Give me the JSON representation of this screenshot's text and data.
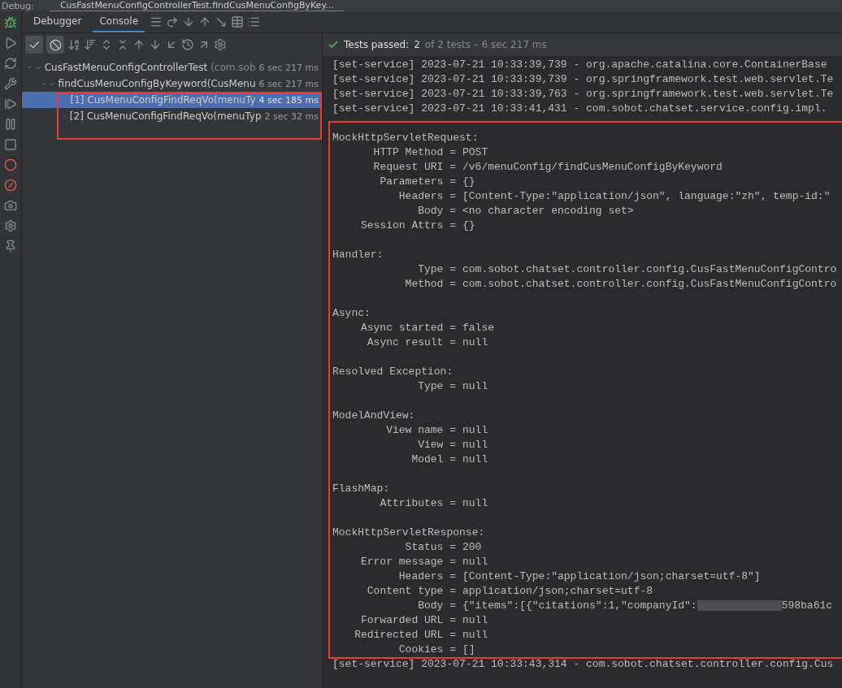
{
  "window": {
    "title": "Debug:",
    "tab": "CusFastMenuConfigControllerTest.findCusMenuConfigByKey..."
  },
  "tabs": [
    {
      "label": "Debugger",
      "selected": false
    },
    {
      "label": "Console",
      "selected": true
    }
  ],
  "filters": [
    {
      "kind": "passed",
      "on": true
    },
    {
      "kind": "ignored",
      "on": true
    }
  ],
  "tree": [
    {
      "name": "CusFastMenuConfigControllerTest",
      "detail": " (com.sob",
      "time": "6 sec 217 ms",
      "expanded": true,
      "selected": false,
      "passed": true,
      "children": [
        {
          "name": "findCusMenuConfigByKeyword(CusMenu",
          "time": "6 sec 217 ms",
          "expanded": true,
          "selected": false,
          "passed": true,
          "children": [
            {
              "name": "[1] CusMenuConfigFindReqVo(menuTy",
              "time": "4 sec 185 ms",
              "selected": true,
              "passed": true
            },
            {
              "name": "[2] CusMenuConfigFindReqVo(menuTyp",
              "time": "2 sec 32 ms",
              "selected": false,
              "passed": true
            }
          ]
        }
      ]
    }
  ],
  "status": {
    "label": "Tests passed:",
    "count": "2",
    "detail": "of 2 tests – 6 sec 217 ms",
    "passed": true
  },
  "console": [
    {
      "kind": "log",
      "text": "[set-service] 2023-07-21 10:33:39,739 - org.apache.catalina.core.ContainerBase"
    },
    {
      "kind": "log",
      "text": "[set-service] 2023-07-21 10:33:39,739 - org.springframework.test.web.servlet.Te"
    },
    {
      "kind": "log",
      "text": "[set-service] 2023-07-21 10:33:39,763 - org.springframework.test.web.servlet.Te"
    },
    {
      "kind": "log",
      "text": "[set-service] 2023-07-21 10:33:41,431 - com.sobot.chatset.service.config.impl."
    },
    {
      "kind": "blank"
    },
    {
      "kind": "heading",
      "text": "MockHttpServletRequest:"
    },
    {
      "kind": "field",
      "key": "HTTP Method =",
      "value": "POST"
    },
    {
      "kind": "field",
      "key": "Request URI =",
      "value": "/v6/menuConfig/findCusMenuConfigByKeyword"
    },
    {
      "kind": "field",
      "key": "Parameters =",
      "value": "{}"
    },
    {
      "kind": "field",
      "key": "Headers =",
      "value": "[Content-Type:\"application/json\", language:\"zh\", temp-id:\""
    },
    {
      "kind": "field",
      "key": "Body =",
      "value": "<no character encoding set>"
    },
    {
      "kind": "field",
      "key": "Session Attrs =",
      "value": "{}"
    },
    {
      "kind": "blank"
    },
    {
      "kind": "heading",
      "text": "Handler:"
    },
    {
      "kind": "field",
      "key": "Type =",
      "value": "com.sobot.chatset.controller.config.CusFastMenuConfigContro"
    },
    {
      "kind": "field",
      "key": "Method =",
      "value": "com.sobot.chatset.controller.config.CusFastMenuConfigContro"
    },
    {
      "kind": "blank"
    },
    {
      "kind": "heading",
      "text": "Async:"
    },
    {
      "kind": "field",
      "key": "Async started =",
      "value": "false"
    },
    {
      "kind": "field",
      "key": "Async result =",
      "value": "null"
    },
    {
      "kind": "blank"
    },
    {
      "kind": "heading",
      "text": "Resolved Exception:"
    },
    {
      "kind": "field",
      "key": "Type =",
      "value": "null"
    },
    {
      "kind": "blank"
    },
    {
      "kind": "heading",
      "text": "ModelAndView:"
    },
    {
      "kind": "field",
      "key": "View name =",
      "value": "null"
    },
    {
      "kind": "field",
      "key": "View =",
      "value": "null"
    },
    {
      "kind": "field",
      "key": "Model =",
      "value": "null"
    },
    {
      "kind": "blank"
    },
    {
      "kind": "heading",
      "text": "FlashMap:"
    },
    {
      "kind": "field",
      "key": "Attributes =",
      "value": "null"
    },
    {
      "kind": "blank"
    },
    {
      "kind": "heading",
      "text": "MockHttpServletResponse:"
    },
    {
      "kind": "field",
      "key": "Status =",
      "value": "200"
    },
    {
      "kind": "field",
      "key": "Error message =",
      "value": "null"
    },
    {
      "kind": "field",
      "key": "Headers =",
      "value": "[Content-Type:\"application/json;charset=utf-8\"]"
    },
    {
      "kind": "field",
      "key": "Content type =",
      "value": "application/json;charset=utf-8"
    },
    {
      "kind": "field",
      "key": "Body =",
      "value": "{\"items\":[{\"citations\":1,\"companyId\":",
      "redacted": true,
      "tail": "598ba61c"
    },
    {
      "kind": "field",
      "key": "Forwarded URL =",
      "value": "null"
    },
    {
      "kind": "field",
      "key": "Redirected URL =",
      "value": "null"
    },
    {
      "kind": "field",
      "key": "Cookies =",
      "value": "[]"
    },
    {
      "kind": "log",
      "text": "[set-service] 2023-07-21 10:33:43,314 - com.sobot.chatset.controller.config.Cus"
    }
  ]
}
